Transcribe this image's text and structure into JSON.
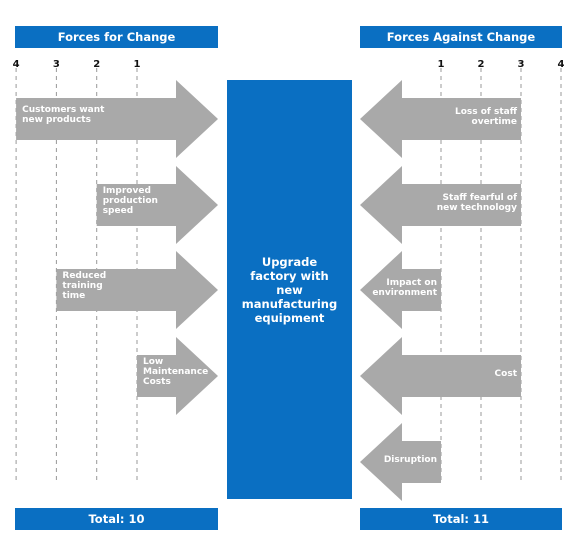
{
  "colors": {
    "accent": "#0a6fc2",
    "arrow": "#a9a9a9"
  },
  "left": {
    "title": "Forces for Change",
    "ticks": [
      "4",
      "3",
      "2",
      "1"
    ],
    "total": "Total: 10",
    "forces": [
      {
        "label": [
          "Customers want",
          "new products"
        ],
        "score": 4
      },
      {
        "label": [
          "Improved",
          "production",
          "speed"
        ],
        "score": 2
      },
      {
        "label": [
          "Reduced",
          "training",
          "time"
        ],
        "score": 3
      },
      {
        "label": [
          "Low",
          "Maintenance",
          "Costs"
        ],
        "score": 1
      }
    ]
  },
  "right": {
    "title": "Forces Against Change",
    "ticks": [
      "1",
      "2",
      "3",
      "4"
    ],
    "total": "Total: 11",
    "forces": [
      {
        "label": [
          "Loss of staff",
          "overtime"
        ],
        "score": 3
      },
      {
        "label": [
          "Staff fearful of",
          "new technology"
        ],
        "score": 3
      },
      {
        "label": [
          "Impact on",
          "environment"
        ],
        "score": 1
      },
      {
        "label": [
          "Cost"
        ],
        "score": 3
      },
      {
        "label": [
          "Disruption"
        ],
        "score": 1
      }
    ]
  },
  "center": {
    "label": "Upgrade factory with new manufacturing equipment"
  }
}
